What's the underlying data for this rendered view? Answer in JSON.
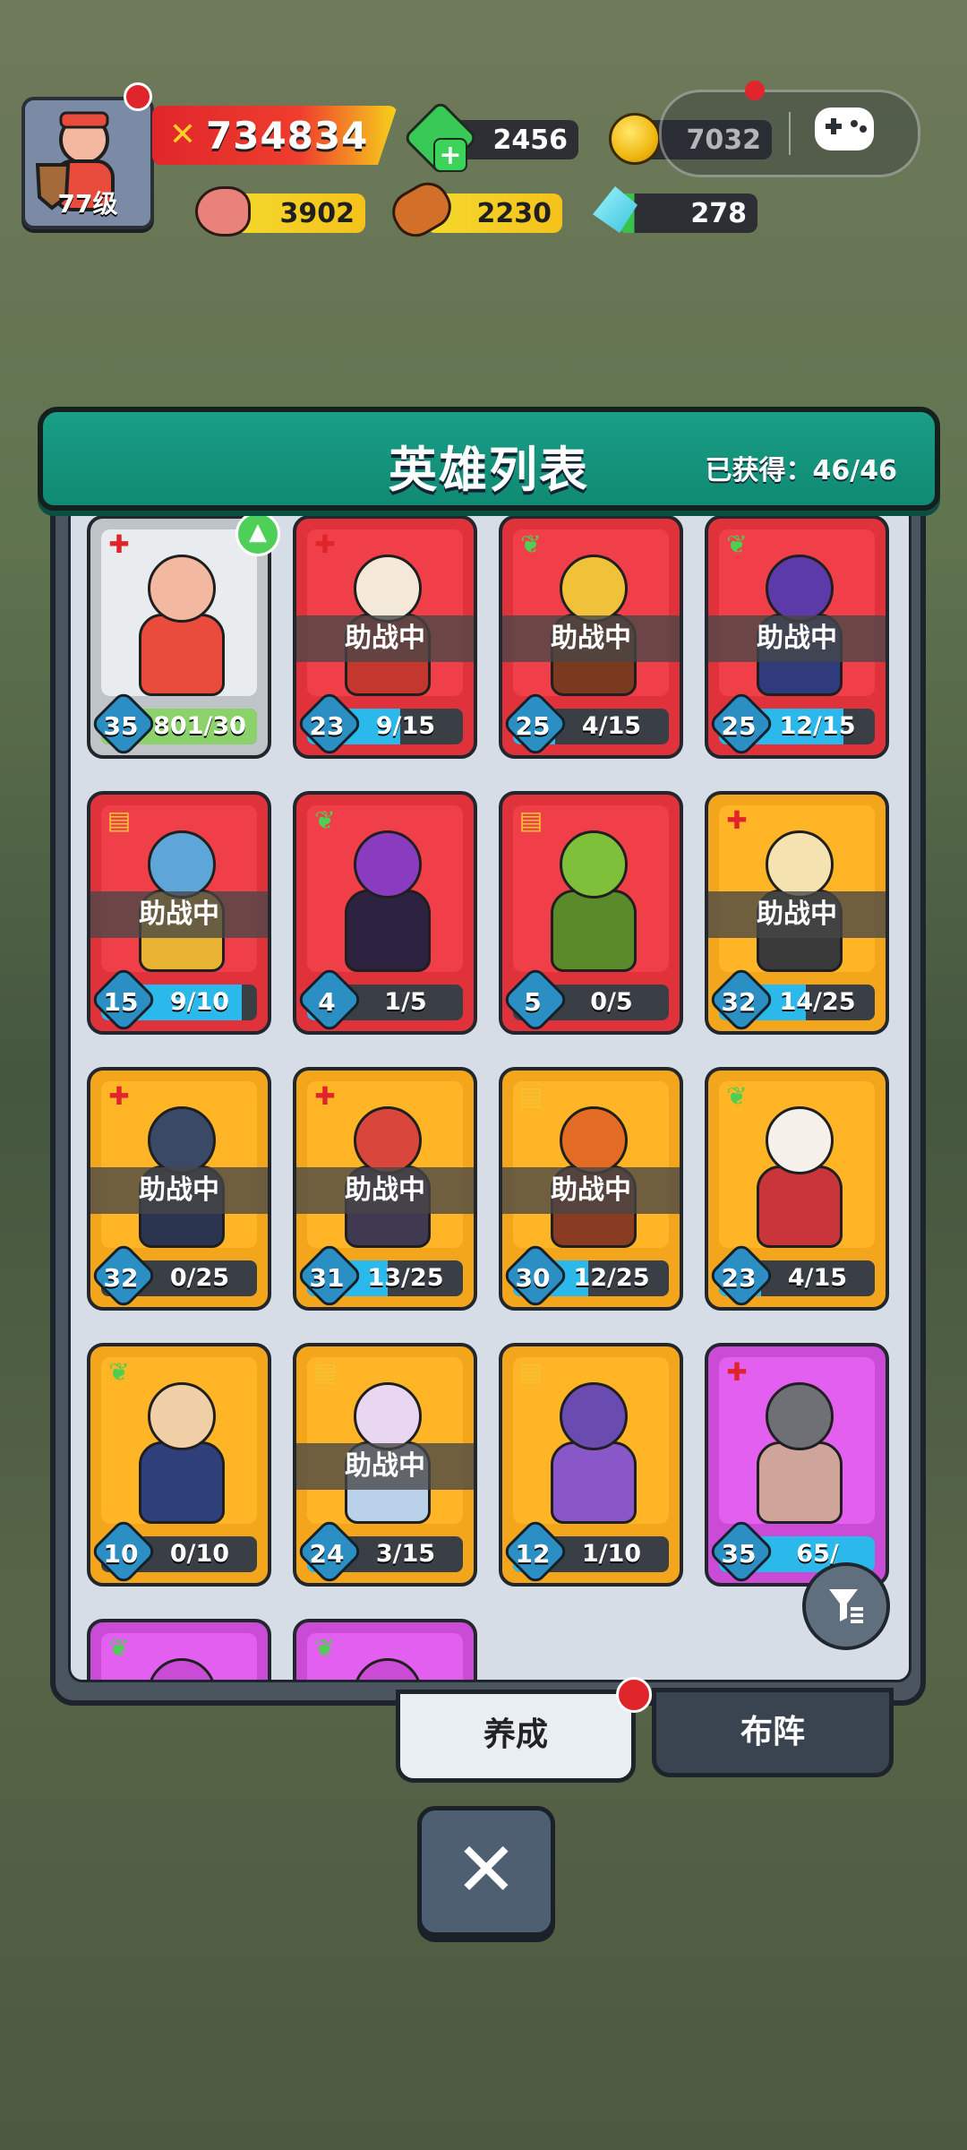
{
  "hud": {
    "player_level": "77级",
    "power": "734834",
    "gem": "2456",
    "gold": "7032",
    "meat": "3902",
    "wood": "2230",
    "crystal": "278"
  },
  "panel": {
    "title": "英雄列表",
    "obtained": "已获得：46/46",
    "support_label": "助战中"
  },
  "heroes": [
    {
      "rarity": "grey",
      "class": "str",
      "level": "35",
      "progress": "801/30",
      "fill": 1.0,
      "supporting": false,
      "upgrade": true,
      "head": "#f2b8a0",
      "body": "#e94b3c"
    },
    {
      "rarity": "red",
      "class": "str",
      "level": "23",
      "progress": "9/15",
      "fill": 0.6,
      "supporting": true,
      "head": "#f4e9d8",
      "body": "#c4372f"
    },
    {
      "rarity": "red",
      "class": "agi",
      "level": "25",
      "progress": "4/15",
      "fill": 0.27,
      "supporting": true,
      "head": "#f0c23a",
      "body": "#7b3a1f"
    },
    {
      "rarity": "red",
      "class": "agi",
      "level": "25",
      "progress": "12/15",
      "fill": 0.8,
      "supporting": true,
      "head": "#5c3aa8",
      "body": "#2f3b7a"
    },
    {
      "rarity": "red",
      "class": "int",
      "level": "15",
      "progress": "9/10",
      "fill": 0.9,
      "supporting": true,
      "head": "#5ea6d8",
      "body": "#e8b232"
    },
    {
      "rarity": "red",
      "class": "agi",
      "level": "4",
      "progress": "1/5",
      "fill": 0.2,
      "supporting": false,
      "head": "#8a3cc0",
      "body": "#2d2340"
    },
    {
      "rarity": "red",
      "class": "int",
      "level": "5",
      "progress": "0/5",
      "fill": 0.0,
      "supporting": false,
      "head": "#7fc03a",
      "body": "#5a8a2a"
    },
    {
      "rarity": "orange",
      "class": "str",
      "level": "32",
      "progress": "14/25",
      "fill": 0.56,
      "supporting": true,
      "head": "#f4e2b0",
      "body": "#3a3a3a"
    },
    {
      "rarity": "orange",
      "class": "str",
      "level": "32",
      "progress": "0/25",
      "fill": 0.0,
      "supporting": true,
      "head": "#3a4a66",
      "body": "#2b3550"
    },
    {
      "rarity": "orange",
      "class": "str",
      "level": "31",
      "progress": "13/25",
      "fill": 0.52,
      "supporting": true,
      "head": "#d9463b",
      "body": "#3f3a52"
    },
    {
      "rarity": "orange",
      "class": "int",
      "level": "30",
      "progress": "12/25",
      "fill": 0.48,
      "supporting": true,
      "head": "#e46b24",
      "body": "#8a3c22"
    },
    {
      "rarity": "orange",
      "class": "agi",
      "level": "23",
      "progress": "4/15",
      "fill": 0.27,
      "supporting": false,
      "head": "#f5f0ea",
      "body": "#c9363a"
    },
    {
      "rarity": "orange",
      "class": "agi",
      "level": "10",
      "progress": "0/10",
      "fill": 0.0,
      "supporting": false,
      "head": "#f1cfa6",
      "body": "#2f3f7a"
    },
    {
      "rarity": "orange",
      "class": "int",
      "level": "24",
      "progress": "3/15",
      "fill": 0.2,
      "supporting": true,
      "head": "#e9d7f2",
      "body": "#b9d2ea"
    },
    {
      "rarity": "orange",
      "class": "int",
      "level": "12",
      "progress": "1/10",
      "fill": 0.1,
      "supporting": false,
      "head": "#6a4bb0",
      "body": "#8a57c8"
    },
    {
      "rarity": "purple",
      "class": "str",
      "level": "35",
      "progress": "65/",
      "fill": 1.0,
      "supporting": false,
      "head": "#6e7076",
      "body": "#cfa49a"
    },
    {
      "rarity": "purple",
      "class": "agi",
      "level": "",
      "progress": "",
      "fill": 0.0,
      "supporting": false,
      "head": "#c94bd6",
      "body": "#c94bd6"
    },
    {
      "rarity": "purple",
      "class": "agi",
      "level": "",
      "progress": "",
      "fill": 0.0,
      "supporting": false,
      "head": "#c94bd6",
      "body": "#c94bd6"
    }
  ],
  "tabs": {
    "train": "养成",
    "formation": "布阵"
  },
  "close_icon": "✕",
  "filter_icon": "filter-icon"
}
